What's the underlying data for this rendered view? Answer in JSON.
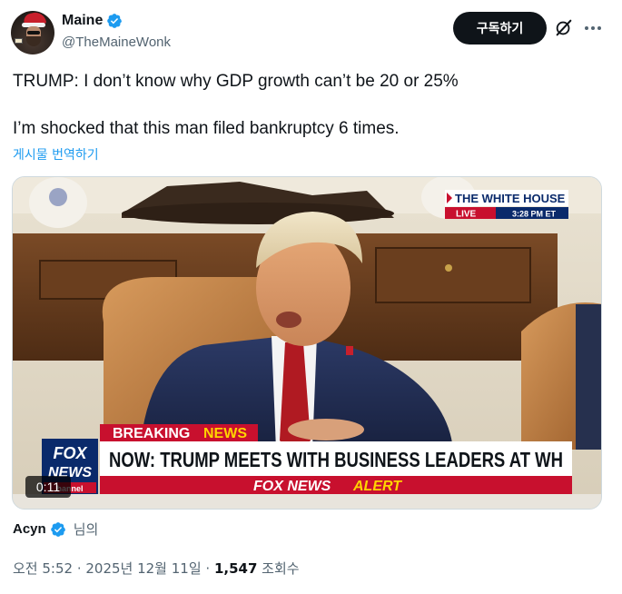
{
  "author": {
    "name": "Maine",
    "handle": "@TheMaineWonk"
  },
  "actions": {
    "subscribe_label": "구독하기"
  },
  "icons": {
    "grok": "grok-slash-icon",
    "more": "more-horizontal-icon",
    "verified": "verified-badge-icon"
  },
  "colors": {
    "verified": "#1d9bf0",
    "link": "#1d9bf0",
    "secondary": "#536471",
    "fox_red": "#c8102e",
    "fox_blue": "#0a2a6b"
  },
  "tweet": {
    "line1": "TRUMP: I don’t know why GDP growth can’t be 20 or 25%",
    "line2": "I’m shocked that this man filed bankruptcy 6 times.",
    "translate_label": "게시물 번역하기"
  },
  "video": {
    "time": "0:11",
    "network_bug": "THE WHITE HOUSE",
    "live_label": "LIVE",
    "live_time": "3:28 PM ET",
    "breaking_label": "BREAKING",
    "news_label": "NEWS",
    "headline": "NOW: TRUMP MEETS WITH BUSINESS LEADERS AT WH",
    "alert_prefix": "FOX NEWS",
    "alert_word": "ALERT",
    "logo_top": "FOX",
    "logo_mid": "NEWS",
    "logo_bottom": "hannel"
  },
  "attribution": {
    "name": "Acyn",
    "suffix": "님의"
  },
  "meta": {
    "time_date": "오전 5:52 · 2025년 12월 11일 · ",
    "views": "1,547",
    "views_label": " 조회수"
  }
}
